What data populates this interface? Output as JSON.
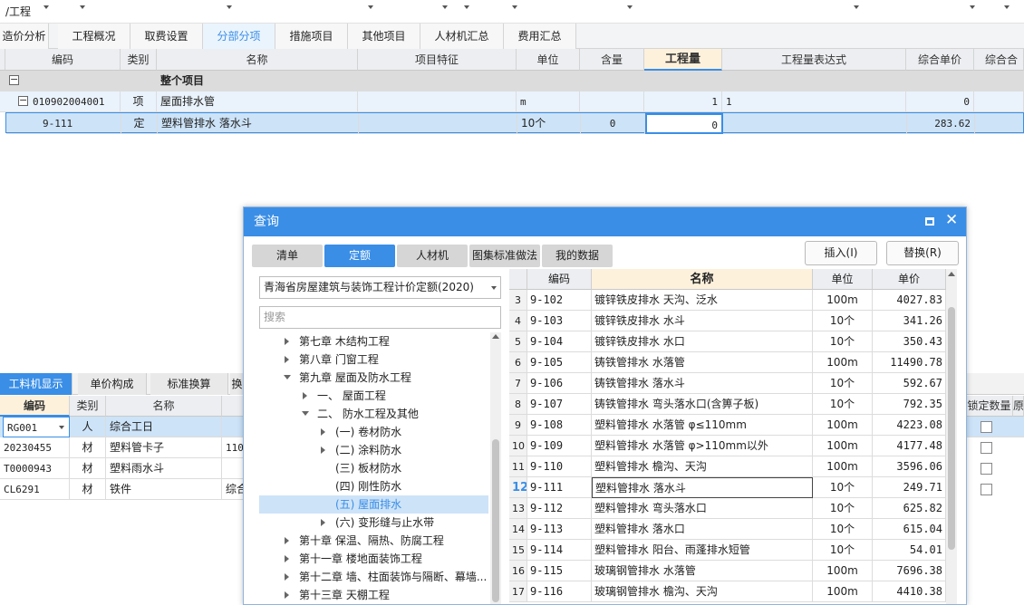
{
  "toolbar": {
    "path": "/工程"
  },
  "tabs": [
    "造价分析",
    "工程概况",
    "取费设置",
    "分部分项",
    "措施项目",
    "其他项目",
    "人材机汇总",
    "费用汇总"
  ],
  "grid": {
    "headers": [
      "编码",
      "类别",
      "名称",
      "项目特征",
      "单位",
      "含量",
      "工程量",
      "工程量表达式",
      "综合单价",
      "综合合价"
    ],
    "rows": [
      {
        "code": "",
        "type": "",
        "name": "整个项目",
        "unit": "",
        "content": "",
        "qty": "",
        "expr": "",
        "price": ""
      },
      {
        "code": "010902004001",
        "type": "项",
        "name": "屋面排水管",
        "unit": "m",
        "content": "",
        "qty": "1",
        "expr": "1",
        "price": "0"
      },
      {
        "code": "9-111",
        "type": "定",
        "name": "塑料管排水 落水斗",
        "unit": "10个",
        "content": "0",
        "qty": "0",
        "expr": "",
        "price": "283.62"
      }
    ]
  },
  "bottom": {
    "tabs": [
      "工料机显示",
      "单价构成",
      "标准换算",
      "换"
    ],
    "headers": [
      "编码",
      "类别",
      "名称"
    ],
    "rows": [
      {
        "code": "RG001",
        "type": "人",
        "name": "综合工日",
        "extra": ""
      },
      {
        "code": "20230455",
        "type": "材",
        "name": "塑料管卡子",
        "extra": "110"
      },
      {
        "code": "T0000943",
        "type": "材",
        "name": "塑料雨水斗",
        "extra": ""
      },
      {
        "code": "CL6291",
        "type": "材",
        "name": "铁件",
        "extra": "综合"
      }
    ],
    "right_header": "锁定数量",
    "right_header2": "原"
  },
  "dialog": {
    "title": "查询",
    "tabs": [
      "清单",
      "定额",
      "人材机",
      "图集标准做法",
      "我的数据"
    ],
    "insert": "插入(I)",
    "replace": "替换(R)",
    "library": "青海省房屋建筑与装饰工程计价定额(2020)",
    "search_placeholder": "搜索",
    "tree": [
      "第七章 木结构工程",
      "第八章 门窗工程",
      "第九章 屋面及防水工程",
      "一、 屋面工程",
      "二、 防水工程及其他",
      "(一) 卷材防水",
      "(二) 涂料防水",
      "(三) 板材防水",
      "(四) 刚性防水",
      "(五) 屋面排水",
      "(六) 变形缝与止水带",
      "第十章 保温、隔热、防腐工程",
      "第十一章 楼地面装饰工程",
      "第十二章 墙、柱面装饰与隔断、幕墙...",
      "第十三章 天棚工程"
    ],
    "table_headers": [
      "编码",
      "名称",
      "单位",
      "单价"
    ],
    "rows": [
      {
        "n": "3",
        "code": "9-102",
        "name": "镀锌铁皮排水 天沟、泛水",
        "unit": "100m",
        "price": "4027.83"
      },
      {
        "n": "4",
        "code": "9-103",
        "name": "镀锌铁皮排水 水斗",
        "unit": "10个",
        "price": "341.26"
      },
      {
        "n": "5",
        "code": "9-104",
        "name": "镀锌铁皮排水 水口",
        "unit": "10个",
        "price": "350.43"
      },
      {
        "n": "6",
        "code": "9-105",
        "name": "铸铁管排水 水落管",
        "unit": "100m",
        "price": "11490.78"
      },
      {
        "n": "7",
        "code": "9-106",
        "name": "铸铁管排水 落水斗",
        "unit": "10个",
        "price": "592.67"
      },
      {
        "n": "8",
        "code": "9-107",
        "name": "铸铁管排水 弯头落水口(含箅子板)",
        "unit": "10个",
        "price": "792.35"
      },
      {
        "n": "9",
        "code": "9-108",
        "name": "塑料管排水 水落管 φ≤110mm",
        "unit": "100m",
        "price": "4223.08"
      },
      {
        "n": "10",
        "code": "9-109",
        "name": "塑料管排水 水落管 φ>110mm以外",
        "unit": "100m",
        "price": "4177.48"
      },
      {
        "n": "11",
        "code": "9-110",
        "name": "塑料管排水 檐沟、天沟",
        "unit": "100m",
        "price": "3596.06"
      },
      {
        "n": "12",
        "code": "9-111",
        "name": "塑料管排水 落水斗",
        "unit": "10个",
        "price": "249.71"
      },
      {
        "n": "13",
        "code": "9-112",
        "name": "塑料管排水 弯头落水口",
        "unit": "10个",
        "price": "625.82"
      },
      {
        "n": "14",
        "code": "9-113",
        "name": "塑料管排水 落水口",
        "unit": "10个",
        "price": "615.04"
      },
      {
        "n": "15",
        "code": "9-114",
        "name": "塑料管排水 阳台、雨蓬排水短管",
        "unit": "10个",
        "price": "54.01"
      },
      {
        "n": "16",
        "code": "9-115",
        "name": "玻璃钢管排水 水落管",
        "unit": "100m",
        "price": "7696.38"
      },
      {
        "n": "17",
        "code": "9-116",
        "name": "玻璃钢管排水 檐沟、天沟",
        "unit": "100m",
        "price": "4410.38"
      }
    ]
  },
  "colors": {
    "accent": "#3a8ee6",
    "selected_row": "#cde3f8",
    "row_light": "#eaf3fc"
  }
}
